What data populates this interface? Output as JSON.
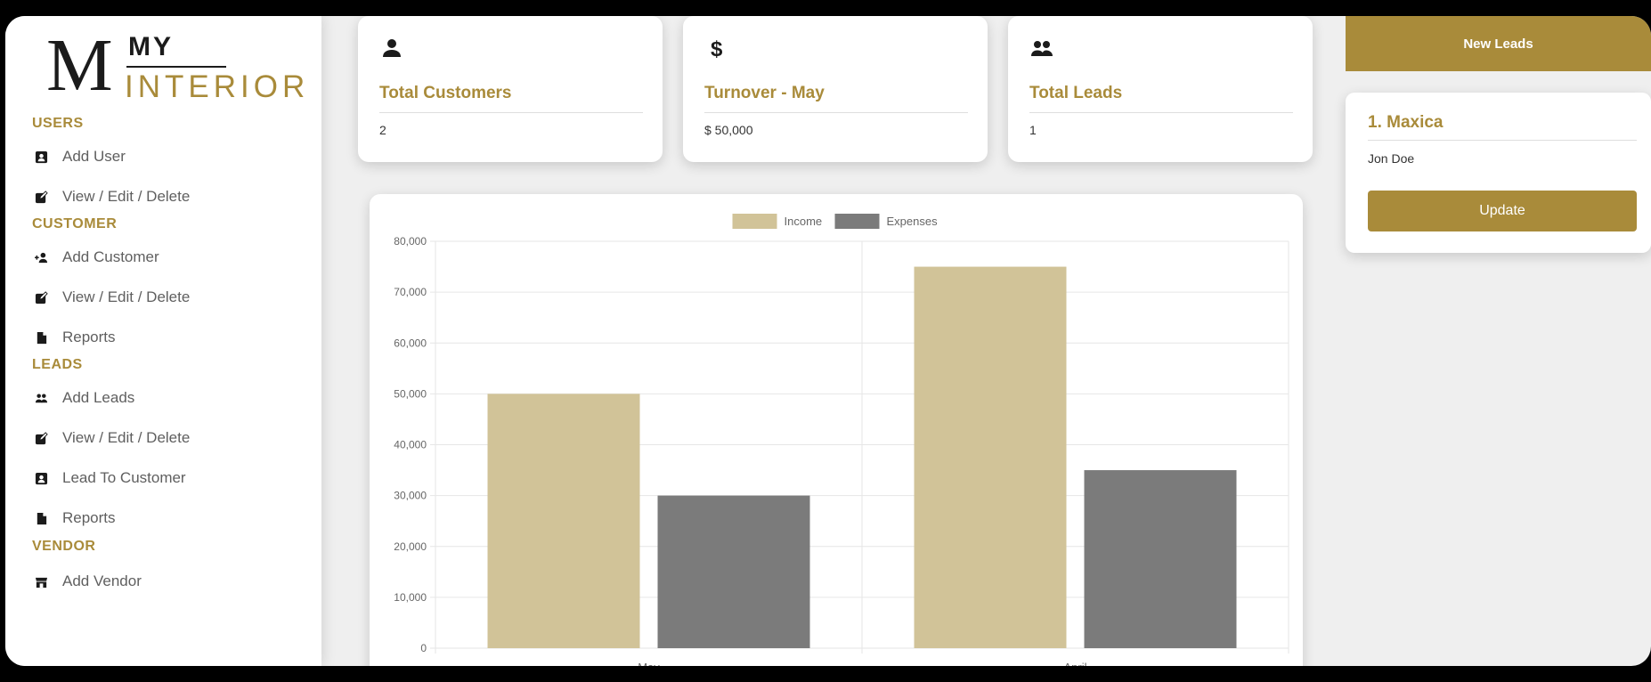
{
  "brand": {
    "logo_m": "M",
    "logo_my": "MY",
    "logo_interior": "INTERIOR"
  },
  "sidebar": {
    "sections": [
      {
        "title": "USERS",
        "items": [
          {
            "label": "Add User",
            "icon": "user-card-icon"
          },
          {
            "label": "View / Edit / Delete",
            "icon": "edit-icon"
          }
        ]
      },
      {
        "title": "CUSTOMER",
        "items": [
          {
            "label": "Add Customer",
            "icon": "user-plus-icon"
          },
          {
            "label": "View / Edit / Delete",
            "icon": "edit-icon"
          },
          {
            "label": "Reports",
            "icon": "file-icon"
          }
        ]
      },
      {
        "title": "LEADS",
        "items": [
          {
            "label": "Add Leads",
            "icon": "users-icon"
          },
          {
            "label": "View / Edit / Delete",
            "icon": "edit-icon"
          },
          {
            "label": "Lead To Customer",
            "icon": "user-card-icon"
          },
          {
            "label": "Reports",
            "icon": "file-icon"
          }
        ]
      },
      {
        "title": "VENDOR",
        "items": [
          {
            "label": "Add Vendor",
            "icon": "store-icon"
          }
        ]
      }
    ]
  },
  "stats": [
    {
      "title": "Total Customers",
      "value": "2",
      "icon": "user-icon"
    },
    {
      "title": "Turnover - May",
      "value": "$ 50,000",
      "icon": "dollar-icon"
    },
    {
      "title": "Total Leads",
      "value": "1",
      "icon": "users-icon"
    }
  ],
  "chart_data": {
    "type": "bar",
    "categories": [
      "May",
      "April"
    ],
    "series": [
      {
        "name": "Income",
        "values": [
          50000,
          75000
        ],
        "color": "#d1c398"
      },
      {
        "name": "Expenses",
        "values": [
          30000,
          35000
        ],
        "color": "#7b7b7b"
      }
    ],
    "ylim": [
      0,
      80000
    ],
    "yticks": [
      "0",
      "10,000",
      "20,000",
      "30,000",
      "40,000",
      "50,000",
      "60,000",
      "70,000",
      "80,000"
    ],
    "legend": "top",
    "grid": true
  },
  "leads_panel": {
    "header": "New Leads",
    "leads": [
      {
        "title": "1. Maxica",
        "person": "Jon Doe",
        "button": "Update"
      }
    ]
  },
  "colors": {
    "accent": "#a98b3a",
    "income": "#d1c398",
    "expenses": "#7b7b7b"
  }
}
